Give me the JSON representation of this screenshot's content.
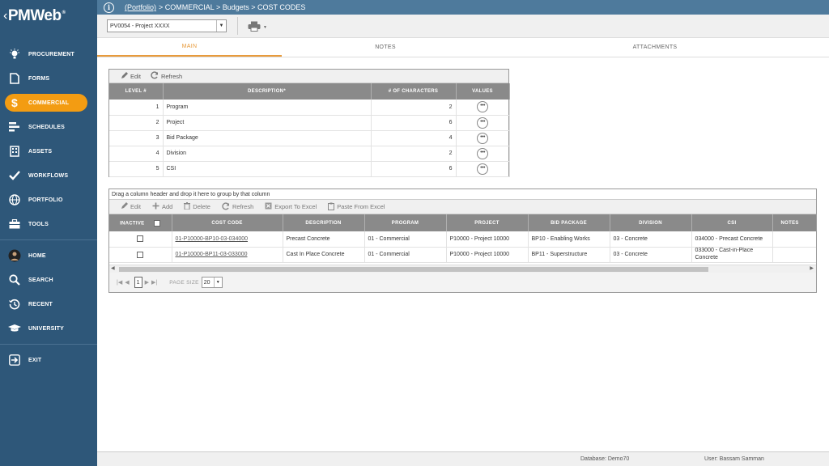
{
  "app": {
    "logo_text": "PMWeb",
    "logo_mark": "®"
  },
  "sidebar": {
    "items": [
      {
        "label": "PROCUREMENT",
        "icon": "lightbulb-icon"
      },
      {
        "label": "FORMS",
        "icon": "document-icon"
      },
      {
        "label": "COMMERCIAL",
        "icon": "dollar-icon",
        "active": true
      },
      {
        "label": "SCHEDULES",
        "icon": "gantt-icon"
      },
      {
        "label": "ASSETS",
        "icon": "building-icon"
      },
      {
        "label": "WORKFLOWS",
        "icon": "checkmark-icon"
      },
      {
        "label": "PORTFOLIO",
        "icon": "globe-icon"
      },
      {
        "label": "TOOLS",
        "icon": "toolbox-icon"
      }
    ],
    "items2": [
      {
        "label": "HOME",
        "icon": "avatar"
      },
      {
        "label": "SEARCH",
        "icon": "search-icon"
      },
      {
        "label": "RECENT",
        "icon": "history-icon"
      },
      {
        "label": "UNIVERSITY",
        "icon": "graduation-cap-icon"
      }
    ],
    "exit_label": "EXIT"
  },
  "breadcrumb": {
    "link": "(Portfolio)",
    "rest": "> COMMERCIAL > Budgets > COST CODES"
  },
  "project_select": {
    "value": "PV0054 - Project XXXX"
  },
  "tabs": {
    "main": "MAIN",
    "notes": "NOTES",
    "attachments": "ATTACHMENTS"
  },
  "levels": {
    "toolbar": {
      "edit": "Edit",
      "refresh": "Refresh"
    },
    "headers": {
      "level": "LEVEL #",
      "description": "DESCRIPTION*",
      "chars": "# OF CHARACTERS",
      "values": "VALUES"
    },
    "rows": [
      {
        "level": "1",
        "description": "Program",
        "chars": "2",
        "values": "•••"
      },
      {
        "level": "2",
        "description": "Project",
        "chars": "6",
        "values": "•••"
      },
      {
        "level": "3",
        "description": "Bid Package",
        "chars": "4",
        "values": "•••"
      },
      {
        "level": "4",
        "description": "Division",
        "chars": "2",
        "values": "•••"
      },
      {
        "level": "5",
        "description": "CSI",
        "chars": "6",
        "values": "•••"
      }
    ]
  },
  "codes": {
    "group_hint": "Drag a column header and drop it here to group by that column",
    "toolbar": {
      "edit": "Edit",
      "add": "Add",
      "delete": "Delete",
      "refresh": "Refresh",
      "export": "Export To Excel",
      "paste": "Paste From Excel"
    },
    "headers": {
      "inactive": "INACTIVE",
      "cost_code": "COST CODE",
      "description": "DESCRIPTION",
      "program": "PROGRAM",
      "project": "PROJECT",
      "bid_package": "BID PACKAGE",
      "division": "DIVISION",
      "csi": "CSI",
      "notes": "NOTES"
    },
    "rows": [
      {
        "cost_code": "01-P10000-BP10-03-034000",
        "description": "Precast Concrete",
        "program": "01 - Commercial",
        "project": "P10000 - Project 10000",
        "bid_package": "BP10 - Enabling Works",
        "division": "03 - Concrete",
        "csi": "034000 - Precast Concrete"
      },
      {
        "cost_code": "01-P10000-BP11-03-033000",
        "description": "Cast In Place Concrete",
        "program": "01 - Commercial",
        "project": "P10000 - Project 10000",
        "bid_package": "BP11 - Superstructure",
        "division": "03 - Concrete",
        "csi": "033000 - Cast-in-Place Concrete"
      }
    ],
    "pager": {
      "page": "1",
      "page_size_label": "PAGE SIZE",
      "page_size": "20"
    }
  },
  "status": {
    "database": "Database:   Demo70",
    "user": "User:   Bassam Samman"
  }
}
